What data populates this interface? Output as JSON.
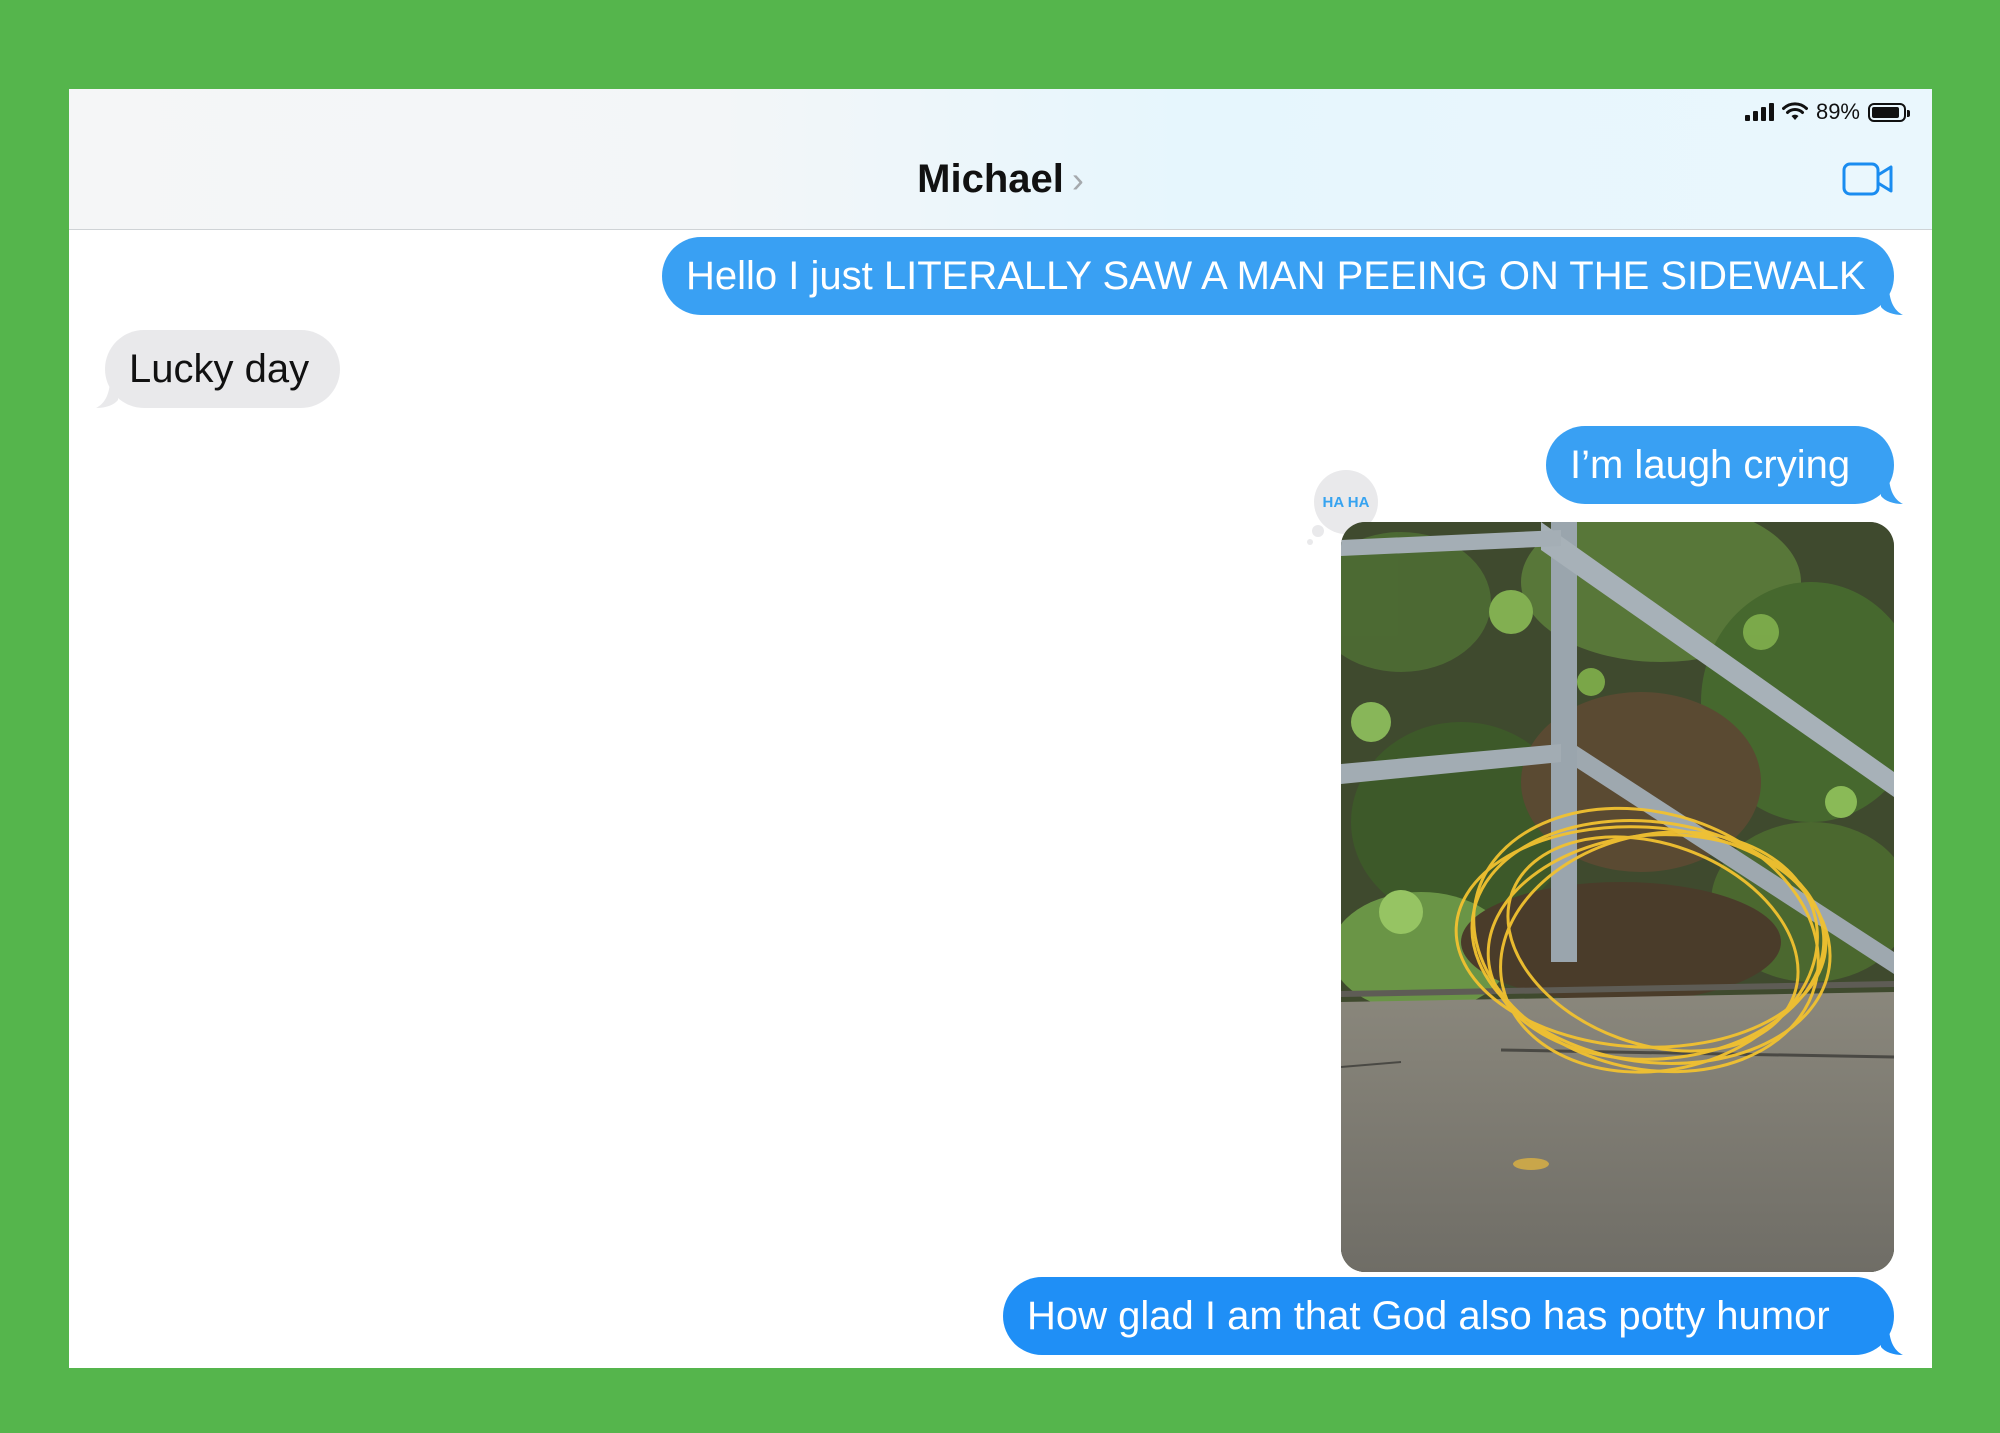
{
  "status_bar": {
    "battery_text": "89%",
    "battery_level": 0.89
  },
  "header": {
    "contact_name": "Michael",
    "chevron": "›",
    "video_icon": "video-camera-icon"
  },
  "messages": [
    {
      "direction": "outgoing",
      "text": "Hello I just LITERALLY SAW A MAN PEEING ON THE SIDEWALK"
    },
    {
      "direction": "incoming",
      "text": "Lucky day"
    },
    {
      "direction": "outgoing",
      "text": "I’m laugh crying"
    },
    {
      "direction": "outgoing",
      "type": "image",
      "image_desc": "photo of railing, plants and pavement with yellow scribbled circle",
      "tapback": "HA HA"
    },
    {
      "direction": "outgoing",
      "text": "How glad I am that God also has potty humor"
    }
  ],
  "colors": {
    "frame_green": "#55b54c",
    "outgoing_bubble": "#39a0f3",
    "incoming_bubble": "#e9e9eb",
    "annotation_yellow": "#f2c230"
  }
}
